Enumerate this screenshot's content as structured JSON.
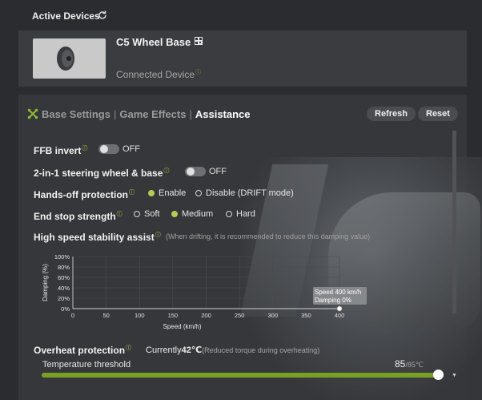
{
  "header": {
    "title": "Active Devices"
  },
  "device": {
    "name": "C5 Wheel Base",
    "status": "Connected Device",
    "info_mark": "ⓘ"
  },
  "tabs": [
    {
      "label": "Base Settings",
      "active": false
    },
    {
      "label": "Game Effects",
      "active": false
    },
    {
      "label": "Assistance",
      "active": true
    }
  ],
  "tab_separator": "|",
  "buttons": {
    "refresh": "Refresh",
    "reset": "Reset"
  },
  "settings": {
    "ffb_invert": {
      "label": "FFB invert",
      "value": "OFF"
    },
    "two_in_one": {
      "label": "2-in-1 steering wheel & base",
      "value": "OFF"
    },
    "hands_off": {
      "label": "Hands-off protection",
      "options": [
        "Enable",
        "Disable (DRIFT mode)"
      ],
      "selected": "Enable"
    },
    "end_stop": {
      "label": "End stop strength",
      "options": [
        "Soft",
        "Medium",
        "Hard"
      ],
      "selected": "Medium"
    },
    "high_speed": {
      "label": "High speed stability assist",
      "hint": "(When drifting, it is recommended to reduce this damping value)"
    }
  },
  "chart_data": {
    "type": "line",
    "xlabel": "Speed (km/h)",
    "ylabel": "Damping (%)",
    "xlim": [
      0,
      400
    ],
    "ylim": [
      0,
      100
    ],
    "x_ticks": [
      "0",
      "50",
      "100",
      "150",
      "200",
      "250",
      "300",
      "350",
      "400"
    ],
    "y_ticks": [
      "0%",
      "20%",
      "40%",
      "60%",
      "80%",
      "100%"
    ],
    "points": [
      {
        "x": 400,
        "y": 0
      }
    ],
    "tooltip": {
      "line1": "Speed 400 km/h",
      "line2": "Damping 0%"
    },
    "grid": true
  },
  "overheat": {
    "label": "Overheat protection",
    "current_prefix": "Currently",
    "current_value": "42℃",
    "note": "(Reduced torque during overheating)",
    "threshold_label": "Temperature threshold",
    "threshold_value": "85",
    "threshold_max": "/85℃",
    "threshold_fraction": 1.0
  },
  "colors": {
    "accent": "#b6cc55",
    "slider": "#79a020",
    "panel": "#35373a"
  }
}
